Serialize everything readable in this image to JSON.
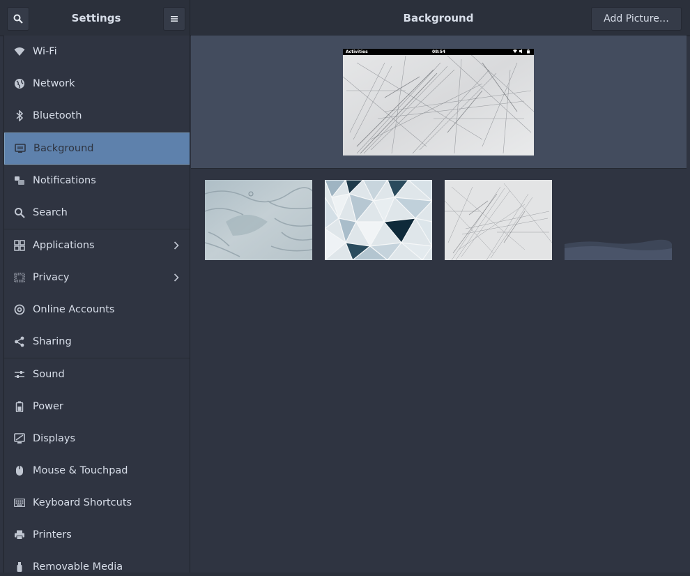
{
  "header": {
    "sidebar_title": "Settings",
    "main_title": "Background",
    "add_button_label": "Add Picture…"
  },
  "sidebar": {
    "items": [
      {
        "label": "Wi-Fi",
        "icon": "wifi-icon"
      },
      {
        "label": "Network",
        "icon": "network-icon"
      },
      {
        "label": "Bluetooth",
        "icon": "bluetooth-icon"
      },
      {
        "label": "Background",
        "icon": "background-icon",
        "active": true
      },
      {
        "label": "Notifications",
        "icon": "notifications-icon"
      },
      {
        "label": "Search",
        "icon": "search-icon"
      },
      {
        "label": "Applications",
        "icon": "applications-icon",
        "has_submenu": true
      },
      {
        "label": "Privacy",
        "icon": "privacy-icon",
        "has_submenu": true
      },
      {
        "label": "Online Accounts",
        "icon": "online-accounts-icon"
      },
      {
        "label": "Sharing",
        "icon": "sharing-icon"
      },
      {
        "label": "Sound",
        "icon": "sound-icon"
      },
      {
        "label": "Power",
        "icon": "power-icon"
      },
      {
        "label": "Displays",
        "icon": "displays-icon"
      },
      {
        "label": "Mouse & Touchpad",
        "icon": "mouse-icon"
      },
      {
        "label": "Keyboard Shortcuts",
        "icon": "keyboard-icon"
      },
      {
        "label": "Printers",
        "icon": "printer-icon"
      },
      {
        "label": "Removable Media",
        "icon": "removable-media-icon"
      }
    ]
  },
  "preview": {
    "activities": "Activities",
    "time": "08:54"
  },
  "colors": {
    "accent": "#5e81ac",
    "sidebar_bg": "#2f3441",
    "preview_bg": "#434c5e"
  }
}
